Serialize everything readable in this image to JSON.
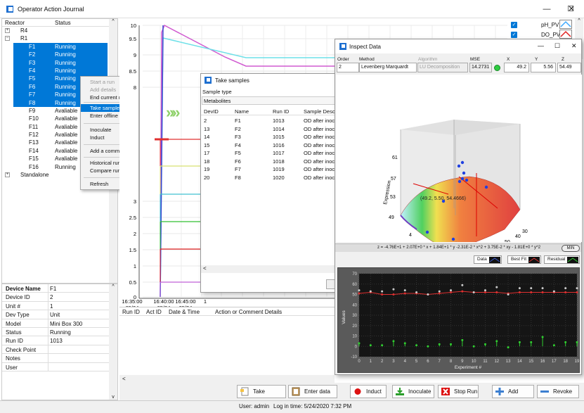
{
  "window": {
    "title": "Operator Action Journal"
  },
  "tree": {
    "col_reactor": "Reactor",
    "col_status": "Status",
    "groups": [
      {
        "name": "R4"
      },
      {
        "name": "R1"
      }
    ],
    "rows": [
      {
        "name": "F1",
        "status": "Running",
        "sel": true
      },
      {
        "name": "F2",
        "status": "Running",
        "sel": true
      },
      {
        "name": "F3",
        "status": "Running",
        "sel": true
      },
      {
        "name": "F4",
        "status": "Running",
        "sel": true
      },
      {
        "name": "F5",
        "status": "Running",
        "sel": true
      },
      {
        "name": "F6",
        "status": "Running",
        "sel": true
      },
      {
        "name": "F7",
        "status": "Running",
        "sel": true
      },
      {
        "name": "F8",
        "status": "Running",
        "sel": true
      },
      {
        "name": "F9",
        "status": "Avaliable",
        "sel": false
      },
      {
        "name": "F10",
        "status": "Avaliable",
        "sel": false
      },
      {
        "name": "F11",
        "status": "Avaliable",
        "sel": false
      },
      {
        "name": "F12",
        "status": "Avaliable",
        "sel": false
      },
      {
        "name": "F13",
        "status": "Avaliable",
        "sel": false
      },
      {
        "name": "F14",
        "status": "Avaliable",
        "sel": false
      },
      {
        "name": "F15",
        "status": "Avaliable",
        "sel": false
      },
      {
        "name": "F16",
        "status": "Running",
        "sel": false
      }
    ],
    "standalone": "Standalone"
  },
  "context_menu": {
    "items": [
      {
        "label": "Start a run",
        "disabled": true
      },
      {
        "label": "Add details",
        "disabled": true
      },
      {
        "label": "End current run",
        "disabled": false
      },
      {
        "label": "Take sample",
        "disabled": false,
        "highlight": true
      },
      {
        "label": "Enter offline data",
        "disabled": false
      },
      {
        "label": "Inoculate",
        "disabled": false
      },
      {
        "label": "Induct",
        "disabled": false
      },
      {
        "label": "Add a comment",
        "disabled": false
      },
      {
        "label": "Historical runs",
        "disabled": false
      },
      {
        "label": "Compare runs",
        "disabled": false
      },
      {
        "label": "Refresh",
        "disabled": false
      }
    ]
  },
  "device": {
    "rows": [
      {
        "k": "Device Name",
        "v": "F1",
        "bold": true
      },
      {
        "k": "Device ID",
        "v": "2"
      },
      {
        "k": "Unit #",
        "v": "1"
      },
      {
        "k": "Dev Type",
        "v": "Unit"
      },
      {
        "k": "Model",
        "v": "Mini Box 300"
      },
      {
        "k": "Status",
        "v": "Running"
      },
      {
        "k": "Run ID",
        "v": "1013"
      },
      {
        "k": "Check Point",
        "v": ""
      },
      {
        "k": "Notes",
        "v": ""
      },
      {
        "k": "User",
        "v": ""
      }
    ]
  },
  "main_chart": {
    "yticks": [
      "10",
      "9.5",
      "9",
      "8.5",
      "8",
      "3",
      "2.5",
      "2",
      "1.5",
      "1",
      "0.5",
      "0"
    ],
    "xticks": [
      {
        "t": "16:35:00",
        "d": "05/24"
      },
      {
        "t": "16:40:00",
        "d": "05/24"
      },
      {
        "t": "16:45:00",
        "d": "05/24"
      },
      {
        "t": "1",
        "d": ""
      }
    ]
  },
  "legend": {
    "items": [
      {
        "label": "pH_PV",
        "color": "#3da9ff"
      },
      {
        "label": "DO_PV",
        "color": "#e02020"
      }
    ]
  },
  "log": {
    "cols": [
      "Run ID",
      "Act ID",
      "Date & Time",
      "Action or Comment Details"
    ]
  },
  "take_samples": {
    "title": "Take samples",
    "type_label": "Sample type",
    "type_value": "Metabolites",
    "cols": [
      "DevID",
      "Name",
      "Run ID",
      "Sample Desc"
    ],
    "rows": [
      [
        "2",
        "F1",
        "1013",
        "OD after inoc"
      ],
      [
        "13",
        "F2",
        "1014",
        "OD after inoc"
      ],
      [
        "14",
        "F3",
        "1015",
        "OD after inoc"
      ],
      [
        "15",
        "F4",
        "1016",
        "OD after inoc"
      ],
      [
        "17",
        "F5",
        "1017",
        "OD after inoc"
      ],
      [
        "18",
        "F6",
        "1018",
        "OD after inoc"
      ],
      [
        "19",
        "F7",
        "1019",
        "OD after inoc"
      ],
      [
        "20",
        "F8",
        "1020",
        "OD after inoc"
      ]
    ]
  },
  "inspect": {
    "title": "Inspect Data",
    "order_label": "Order",
    "order_value": "2",
    "method_label": "Method",
    "method_value": "Levenberg Marquardt",
    "algorithm_label": "Algorithm",
    "algorithm_value": "LU Decomposition",
    "mse_label": "MSE",
    "mse_value": "14.2731",
    "x_label": "X",
    "x_value": "49.2",
    "y_label": "Y",
    "y_value": "5.56",
    "z_label": "Z",
    "z_value": "54.49",
    "annotation": "(49.2, 5.50, 54.4666)",
    "zaxis": "Expression",
    "axis_ticks_z": [
      "61",
      "57",
      "53",
      "49"
    ],
    "axis_ticks_x1": [
      "4",
      "4.5",
      "5",
      "5.5",
      "6"
    ],
    "axis_ticks_x2": [
      "30",
      "40",
      "50",
      "60"
    ],
    "formula": "z = -4.76E+1 + 2.07E+0 * x + 1.84E+1 * y -2.31E-2 * x^2 + 3.75E-2 * xy - 1.81E+0 * y^2",
    "min_label": "MIN",
    "legend": [
      "Data",
      "Best Fit",
      "Residual"
    ],
    "plot_ylabel": "Values",
    "plot_xlabel": "Experiment #",
    "plot_yticks": [
      "70",
      "60",
      "50",
      "40",
      "30",
      "20",
      "10",
      "0",
      "-10"
    ],
    "plot_xticks": [
      "0",
      "1",
      "2",
      "3",
      "4",
      "5",
      "6",
      "7",
      "8",
      "9",
      "10",
      "11",
      "12",
      "13",
      "14",
      "15",
      "16",
      "17",
      "18",
      "19"
    ]
  },
  "buttons": {
    "take": "Take Sample",
    "enter": "Enter data",
    "induct": "Induct",
    "inoculate": "Inoculate",
    "stop": "Stop Run",
    "add": "Add",
    "revoke": "Revoke"
  },
  "status": {
    "user": "User: admin",
    "login": "Log in time: 5/24/2020 7:32 PM"
  }
}
